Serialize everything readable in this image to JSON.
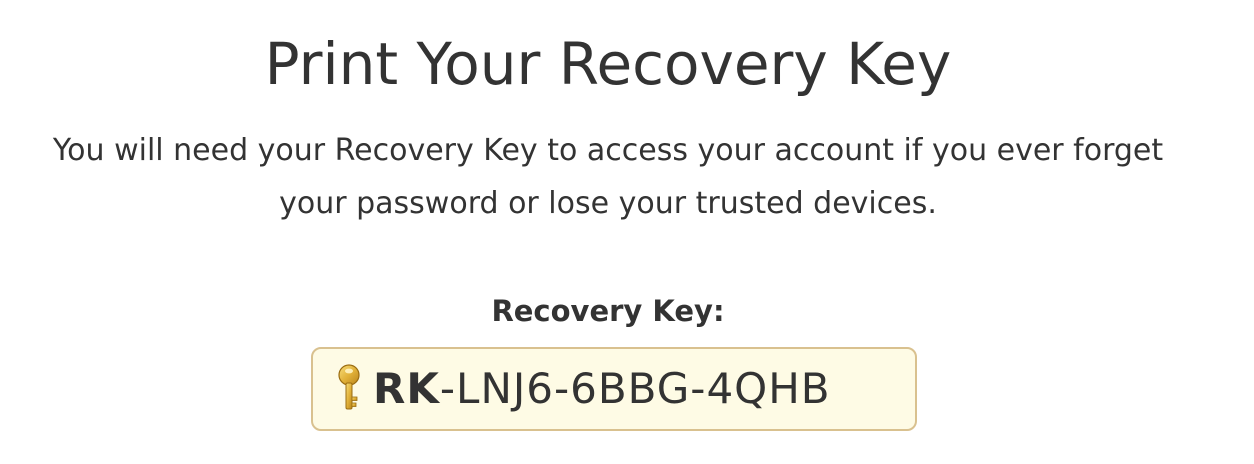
{
  "page": {
    "title": "Print Your Recovery Key",
    "description": "You will need your Recovery Key to access your account if you ever forget your password or lose your trusted devices."
  },
  "recovery_key": {
    "label": "Recovery Key:",
    "prefix": "RK",
    "value": "-LNJ6-6BBG-4QHB",
    "icon": "key-icon"
  },
  "colors": {
    "text": "#333333",
    "key_box_background": "#fefbe5",
    "key_box_border": "#d9c18f",
    "key_icon_gold": "#e2b23a"
  }
}
